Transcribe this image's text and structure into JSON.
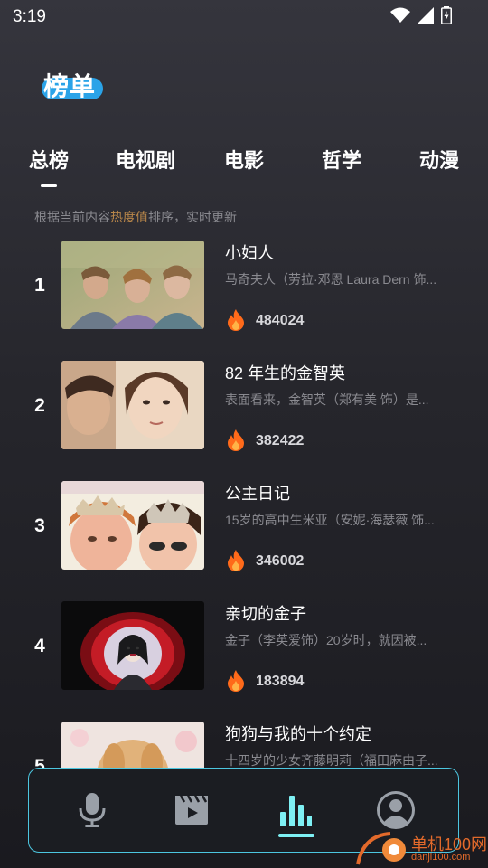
{
  "status_bar": {
    "time": "3:19"
  },
  "header": {
    "logo_text": "榜单"
  },
  "tabs": [
    {
      "label": "总榜",
      "selected": true
    },
    {
      "label": "电视剧"
    },
    {
      "label": "电影"
    },
    {
      "label": "哲学"
    },
    {
      "label": "动漫"
    }
  ],
  "subtitle": {
    "prefix": "根据当前内容",
    "highlight": "热度值",
    "suffix": "排序，实时更新"
  },
  "ranking": [
    {
      "rank": "1",
      "title": "小妇人",
      "desc": "马奇夫人（劳拉·邓恩 Laura Dern 饰...",
      "heat": "484024"
    },
    {
      "rank": "2",
      "title": "82 年生的金智英",
      "desc": "表面看来，金智英（郑有美 饰）是...",
      "heat": "382422"
    },
    {
      "rank": "3",
      "title": "公主日记",
      "desc": "15岁的高中生米亚（安妮·海瑟薇 饰...",
      "heat": "346002"
    },
    {
      "rank": "4",
      "title": "亲切的金子",
      "desc": "金子（李英爱饰）20岁时，就因被...",
      "heat": "183894"
    },
    {
      "rank": "5",
      "title": "狗狗与我的十个约定",
      "desc": "十四岁的少女齐藤明莉（福田麻由子...",
      "heat": ""
    }
  ],
  "bottom_nav": [
    {
      "name": "voice",
      "icon": "microphone-icon"
    },
    {
      "name": "video",
      "icon": "film-icon"
    },
    {
      "name": "ranking",
      "icon": "bar-chart-icon",
      "selected": true
    },
    {
      "name": "profile",
      "icon": "user-avatar-icon"
    }
  ],
  "watermark": {
    "text": "单机100网",
    "url": "danji100.com"
  },
  "colors": {
    "accent": "#7ef0f4",
    "nav_border": "#4cc6e0",
    "logo_blue": "#2aa3e8",
    "heat_orange": "#ff6a1a",
    "highlight": "#b8864a"
  }
}
